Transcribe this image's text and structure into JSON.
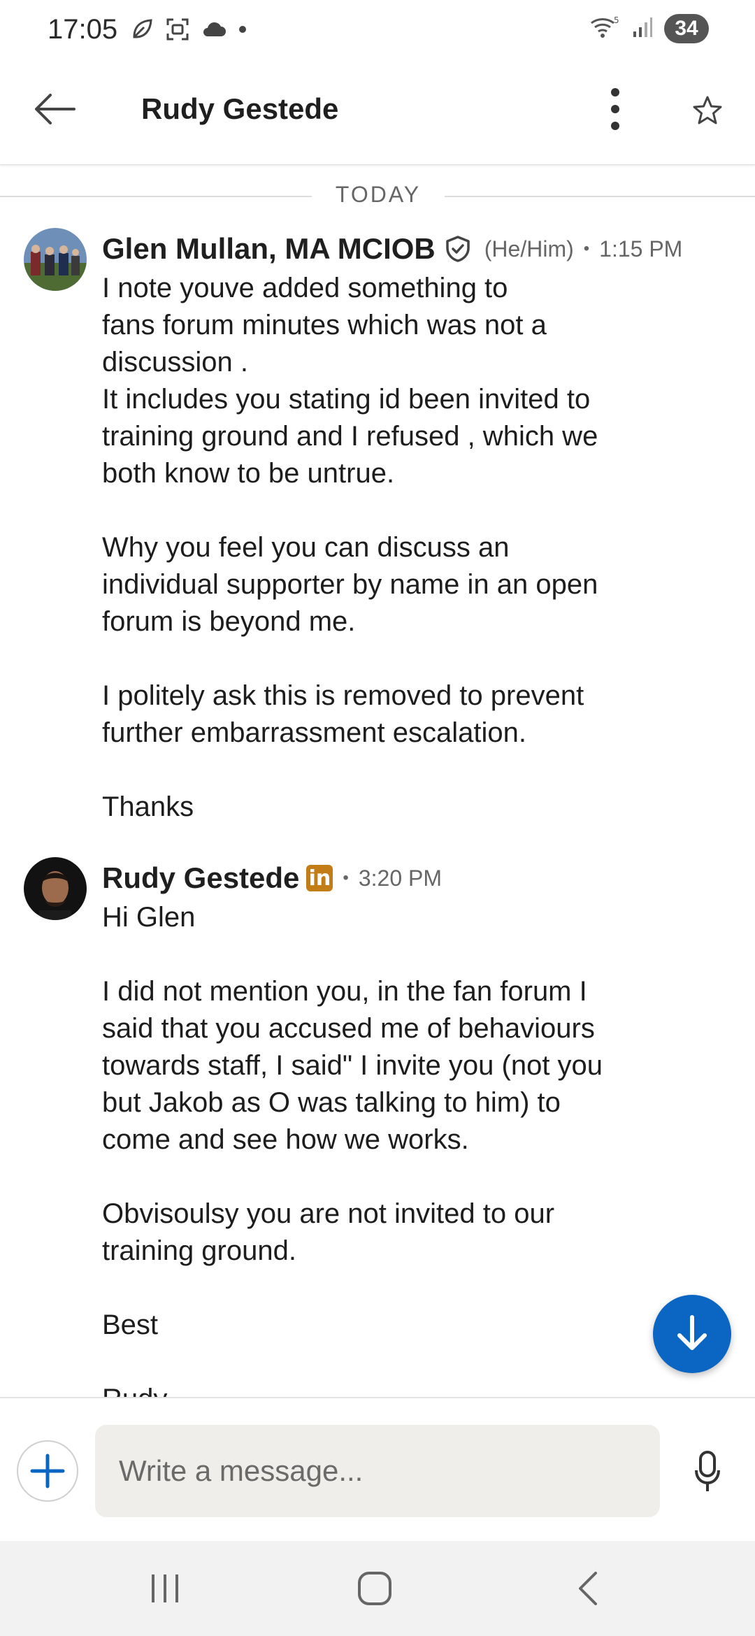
{
  "status_bar": {
    "time": "17:05",
    "battery": "34",
    "icons_left": [
      "leaf-icon",
      "screenshot-icon",
      "cloud-icon",
      "dot-icon"
    ],
    "icons_right": [
      "wifi-icon",
      "signal-icon",
      "battery-icon"
    ]
  },
  "header": {
    "title": "Rudy Gestede",
    "icons": [
      "back-arrow-icon",
      "more-vertical-icon",
      "star-icon"
    ]
  },
  "conversation": {
    "date_divider": "TODAY",
    "messages": [
      {
        "sender": "Glen Mullan, MA MCIOB",
        "pronouns": "(He/Him)",
        "separator": "•",
        "time": "1:15 PM",
        "badge_icon": "shield-check-icon",
        "text": "I note youve added something to\nfans forum minutes which was not a\ndiscussion .\nIt includes you stating id been invited to\ntraining ground and I refused , which we\nboth know to be untrue.\n\nWhy you feel you can discuss an\nindividual supporter by name in an open\nforum is beyond me.\n\nI politely ask this is removed to prevent\nfurther embarrassment escalation.\n\nThanks"
      },
      {
        "sender": "Rudy Gestede",
        "separator": "•",
        "time": "3:20 PM",
        "badge_icon": "linkedin-premium-icon",
        "badge_text": "in",
        "text": "Hi Glen\n\nI did not mention you, in the fan forum I\nsaid that you accused me of behaviours\ntowards staff, I said\" I invite you (not you\nbut Jakob as O was talking to him) to\ncome and see how we works.\n\nObvisoulsy you are not invited to our\ntraining ground.\n\nBest\n\nRudy"
      }
    ]
  },
  "composer": {
    "placeholder": "Write a message...",
    "value": ""
  },
  "colors": {
    "accent": "#0a66c2",
    "premium_badge": "#c37d16"
  },
  "nav_bar": {
    "buttons": [
      "recents-icon",
      "home-icon",
      "back-icon"
    ]
  }
}
